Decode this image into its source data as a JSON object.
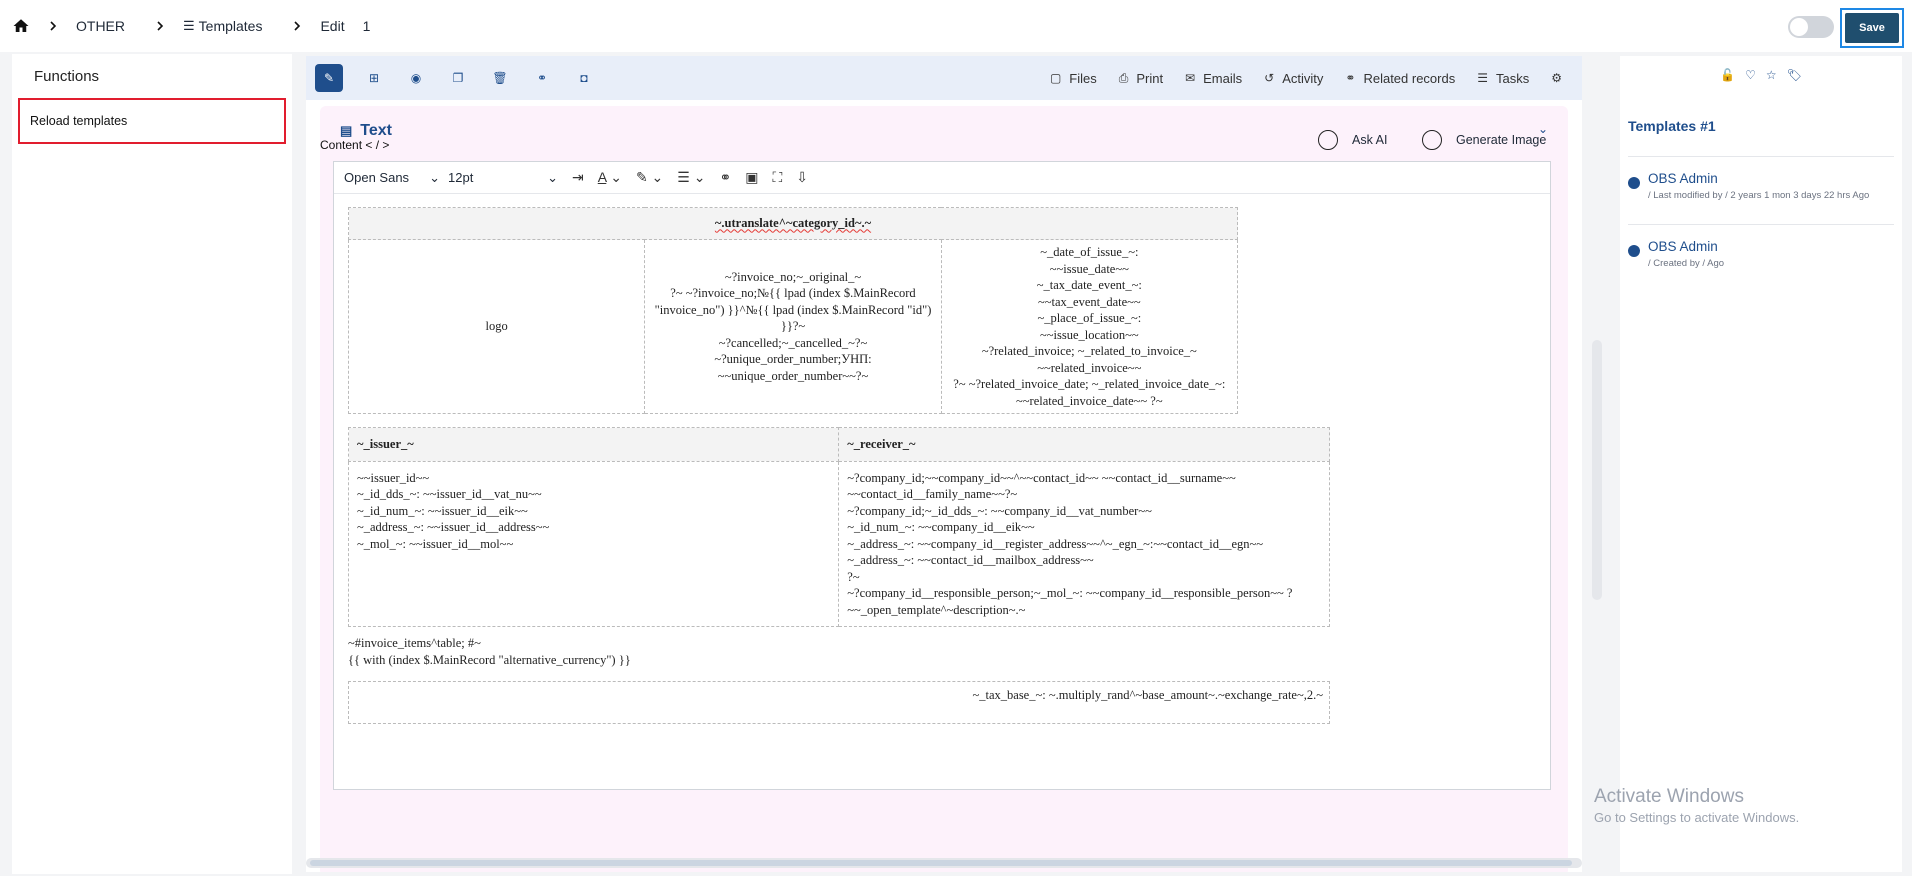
{
  "breadcrumb": {
    "items": [
      "OTHER",
      "Templates",
      "Edit",
      "1"
    ]
  },
  "header": {
    "save_label": "Save",
    "accent": "#1f4e6e",
    "highlight": "#1e88e5"
  },
  "sidebar": {
    "title": "Functions",
    "items": [
      {
        "label": "Reload templates"
      }
    ]
  },
  "toolbar": {
    "icons": [
      "pencil-icon",
      "plus-square-icon",
      "eye-icon",
      "copy-icon",
      "trash-icon",
      "link-icon",
      "camera-icon"
    ],
    "links": [
      "Files",
      "Print",
      "Emails",
      "Activity",
      "Related records",
      "Tasks"
    ]
  },
  "text_card": {
    "title": "Text",
    "content_label": "Content < / >",
    "ask_ai": "Ask AI",
    "generate_image": "Generate Image"
  },
  "editor_toolbar": {
    "font": "Open Sans",
    "size": "12pt"
  },
  "doc": {
    "header": "~.utranslate^~category_id~.~",
    "logo_alt": "logo",
    "col2": [
      "~?invoice_no;~_original_~",
      "?~ ~?invoice_no;№{{ lpad (index $.MainRecord",
      "\"invoice_no\") }}^№{{ lpad (index $.MainRecord \"id\") }}?~",
      "~?cancelled;~_cancelled_~?~",
      "~?unique_order_number;УНП:",
      "~~unique_order_number~~?~"
    ],
    "col3": [
      "~_date_of_issue_~:",
      "~~issue_date~~",
      "~_tax_date_event_~:",
      "~~tax_event_date~~",
      "~_place_of_issue_~:",
      "~~issue_location~~",
      "~?related_invoice; ~_related_to_invoice_~",
      "~~related_invoice~~",
      "?~ ~?related_invoice_date; ~_related_invoice_date_~:",
      "~~related_invoice_date~~ ?~"
    ],
    "issuer_header": "~_issuer_~",
    "receiver_header": "~_receiver_~",
    "issuer_lines": [
      "~~issuer_id~~",
      "~_id_dds_~: ~~issuer_id__vat_nu~~",
      "~_id_num_~: ~~issuer_id__eik~~",
      "~_address_~: ~~issuer_id__address~~",
      "~_mol_~: ~~issuer_id__mol~~"
    ],
    "receiver_lines": [
      "~?company_id;~~company_id~~^~~contact_id~~ ~~contact_id__surname~~",
      "~~contact_id__family_name~~?~",
      "~?company_id;~_id_dds_~: ~~company_id__vat_number~~",
      "~_id_num_~: ~~company_id__eik~~",
      "~_address_~: ~~company_id__register_address~~^~_egn_~:~~contact_id__egn~~",
      "~_address_~: ~~contact_id__mailbox_address~~",
      "?~",
      "~?company_id__responsible_person;~_mol_~: ~~company_id__responsible_person~~ ?",
      "~~_open_template^~description~.~"
    ],
    "after_lines": [
      "~#invoice_items^table; #~",
      "{{ with (index $.MainRecord \"alternative_currency\") }}"
    ],
    "tax_line": "~_tax_base_~: ~.multiply_rand^~base_amount~.~exchange_rate~,2.~"
  },
  "right_panel": {
    "title": "Templates #1",
    "entries": [
      {
        "name": "OBS Admin",
        "meta": "/ Last modified by / 2 years 1 mon 3 days 22 hrs Ago"
      },
      {
        "name": "OBS Admin",
        "meta": "/ Created by / Ago"
      }
    ]
  },
  "watermark": {
    "line1": "Activate Windows",
    "line2": "Go to Settings to activate Windows."
  }
}
